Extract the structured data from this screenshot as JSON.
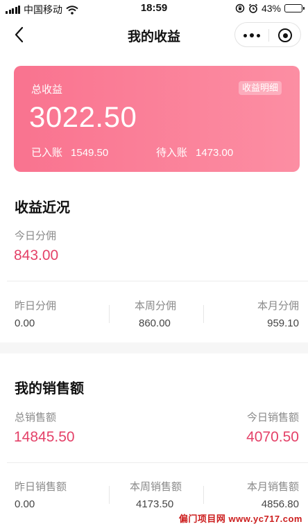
{
  "status_bar": {
    "carrier": "中国移动",
    "time": "18:59",
    "battery": "43%",
    "battery_level": 0.43
  },
  "nav": {
    "title": "我的收益"
  },
  "earnings_card": {
    "label": "总收益",
    "detail_button": "收益明细",
    "total": "3022.50",
    "credited_label": "已入账",
    "credited_value": "1549.50",
    "pending_label": "待入账",
    "pending_value": "1473.00"
  },
  "recent": {
    "title": "收益近况",
    "today_label": "今日分佣",
    "today_value": "843.00",
    "yesterday_label": "昨日分佣",
    "yesterday_value": "0.00",
    "week_label": "本周分佣",
    "week_value": "860.00",
    "month_label": "本月分佣",
    "month_value": "959.10"
  },
  "sales": {
    "title": "我的销售额",
    "total_label": "总销售额",
    "total_value": "14845.50",
    "today_label": "今日销售额",
    "today_value": "4070.50",
    "yesterday_label": "昨日销售额",
    "yesterday_value": "0.00",
    "week_label": "本周销售额",
    "week_value": "4173.50",
    "month_label": "本月销售额",
    "month_value": "4856.80"
  },
  "watermark": "偏门项目网 www.yc717.com",
  "colors": {
    "card_start": "#f9738f",
    "card_end": "#fc8ea3",
    "accent_value": "#e44168"
  }
}
